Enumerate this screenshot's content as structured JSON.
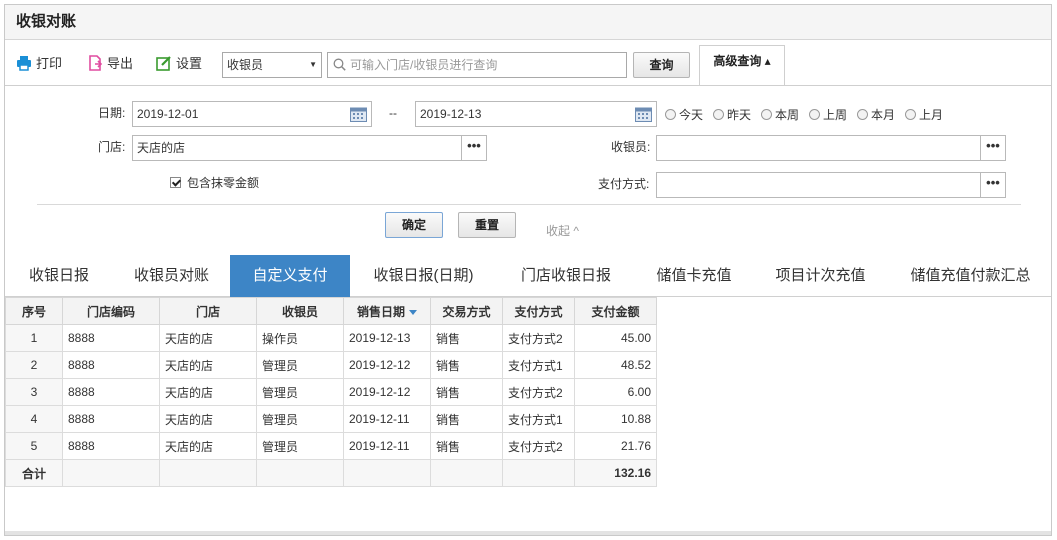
{
  "title": "收银对账",
  "toolbar": {
    "print_label": "打印",
    "export_label": "导出",
    "settings_label": "设置",
    "role_value": "收银员",
    "search_placeholder": "可输入门店/收银员进行查询",
    "query_label": "查询",
    "advanced_label": "高级查询 ▴"
  },
  "filters": {
    "date_label": "日期:",
    "date_from": "2019-12-01",
    "date_sep": "--",
    "date_to": "2019-12-13",
    "quick_dates": [
      "今天",
      "昨天",
      "本周",
      "上周",
      "本月",
      "上月"
    ],
    "store_label": "门店:",
    "store_value": "天店的店",
    "cashier_label": "收银员:",
    "cashier_value": "",
    "include_rounding_label": "包含抹零金额",
    "payment_label": "支付方式:",
    "payment_value": "",
    "confirm_label": "确定",
    "reset_label": "重置",
    "collapse_label": "收起 ^",
    "dots": "•••"
  },
  "tabs": [
    "收银日报",
    "收银员对账",
    "自定义支付",
    "收银日报(日期)",
    "门店收银日报",
    "储值卡充值",
    "项目计次充值",
    "储值充值付款汇总"
  ],
  "active_tab": 2,
  "table": {
    "headers": [
      "序号",
      "门店编码",
      "门店",
      "收银员",
      "销售日期",
      "交易方式",
      "支付方式",
      "支付金额"
    ],
    "rows": [
      [
        "1",
        "8888",
        "天店的店",
        "操作员",
        "2019-12-13",
        "销售",
        "支付方式2",
        "45.00"
      ],
      [
        "2",
        "8888",
        "天店的店",
        "管理员",
        "2019-12-12",
        "销售",
        "支付方式1",
        "48.52"
      ],
      [
        "3",
        "8888",
        "天店的店",
        "管理员",
        "2019-12-12",
        "销售",
        "支付方式2",
        "6.00"
      ],
      [
        "4",
        "8888",
        "天店的店",
        "管理员",
        "2019-12-11",
        "销售",
        "支付方式1",
        "10.88"
      ],
      [
        "5",
        "8888",
        "天店的店",
        "管理员",
        "2019-12-11",
        "销售",
        "支付方式2",
        "21.76"
      ]
    ],
    "total_label": "合计",
    "total_value": "132.16"
  },
  "colors": {
    "accent": "#3d85c6",
    "print_icon": "#1a8fd6",
    "export_icon": "#e04ca0",
    "settings_icon": "#3a9b2f"
  }
}
